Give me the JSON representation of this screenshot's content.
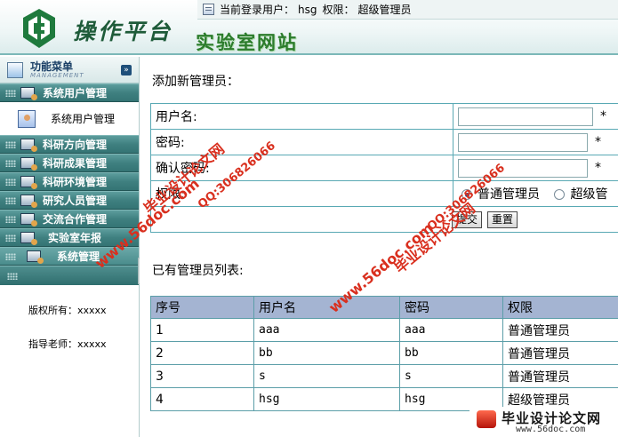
{
  "header": {
    "platform_title": "操作平台",
    "lab_title": "实验室网站",
    "current_user_label": "当前登录用户：",
    "current_user": "hsg",
    "permission_label": "权限：",
    "permission": "超级管理员"
  },
  "sidebar": {
    "menu_title": "功能菜单",
    "menu_subtitle": "MANAGEMENT",
    "items": [
      {
        "label": "系统用户管理"
      },
      {
        "label": "系统用户管理"
      },
      {
        "label": "科研方向管理"
      },
      {
        "label": "科研成果管理"
      },
      {
        "label": "科研环境管理"
      },
      {
        "label": "研究人员管理"
      },
      {
        "label": "交流合作管理"
      },
      {
        "label": "实验室年报"
      },
      {
        "label": "系统管理"
      }
    ],
    "copyright": "版权所有：xxxxx",
    "teacher": "指导老师：xxxxx"
  },
  "main": {
    "add_title": "添加新管理员：",
    "form": {
      "username_label": "用户名:",
      "password_label": "密码:",
      "confirm_label": "确认密码:",
      "permission_label": "权限:",
      "required_mark": "*",
      "option_normal": "普通管理员",
      "option_super": "超级管",
      "submit_label": "提交",
      "reset_label": "重置"
    },
    "list_title": "已有管理员列表:",
    "list": {
      "headers": [
        "序号",
        "用户名",
        "密码",
        "权限"
      ],
      "rows": [
        [
          "1",
          "aaa",
          "aaa",
          "普通管理员"
        ],
        [
          "2",
          "bb",
          "bb",
          "普通管理员"
        ],
        [
          "3",
          "s",
          "s",
          "普通管理员"
        ],
        [
          "4",
          "hsg",
          "hsg",
          "超级管理员"
        ]
      ]
    }
  },
  "watermarks": {
    "site": "www.56doc.com",
    "qq": "QQ:306826066",
    "brand": "毕业设计论文网",
    "badge_url": "www.56doc.com"
  }
}
